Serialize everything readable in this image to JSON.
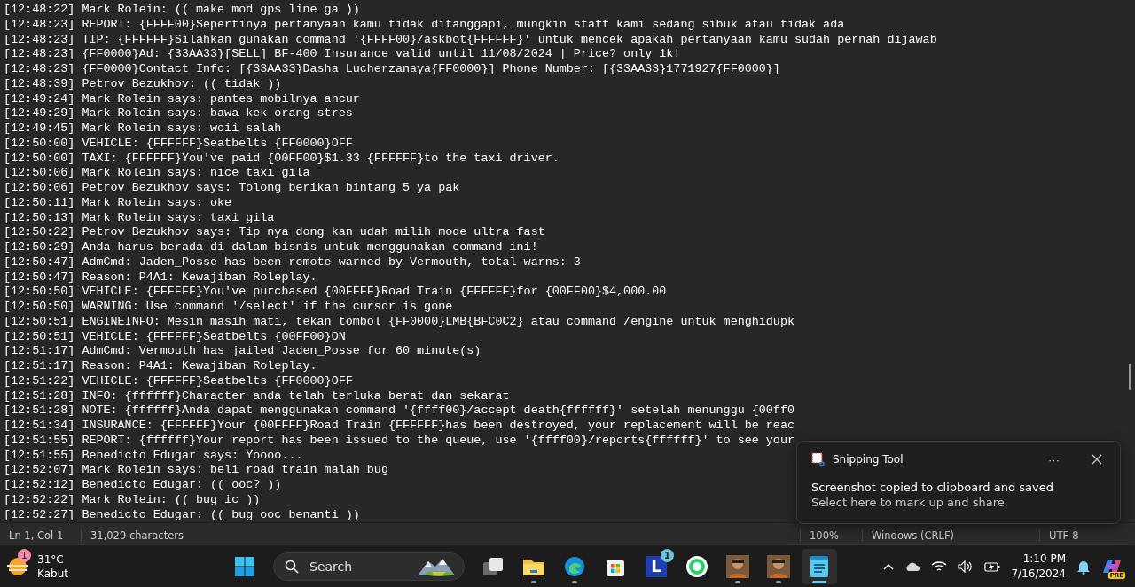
{
  "editor": {
    "lines": [
      "[12:48:22] Mark Rolein: (( make mod gps line ga ))",
      "[12:48:23] REPORT: {FFFF00}Sepertinya pertanyaan kamu tidak ditanggapi, mungkin staff kami sedang sibuk atau tidak ada",
      "[12:48:23] TIP: {FFFFFF}Silahkan gunakan command '{FFFF00}/askbot{FFFFFF}' untuk mencek apakah pertanyaan kamu sudah pernah dijawab",
      "[12:48:23] {FF0000}Ad: {33AA33}[SELL] BF-400 Insurance valid until 11/08/2024 | Price? only 1k!",
      "[12:48:23] {FF0000}Contact Info: [{33AA33}Dasha Lucherzanaya{FF0000}] Phone Number: [{33AA33}1771927{FF0000}]",
      "[12:48:39] Petrov Bezukhov: (( tidak ))",
      "[12:49:24] Mark Rolein says: pantes mobilnya ancur",
      "[12:49:29] Mark Rolein says: bawa kek orang stres",
      "[12:49:45] Mark Rolein says: woii salah",
      "[12:50:00] VEHICLE: {FFFFFF}Seatbelts {FF0000}OFF",
      "[12:50:00] TAXI: {FFFFFF}You've paid {00FF00}$1.33 {FFFFFF}to the taxi driver.",
      "[12:50:06] Mark Rolein says: nice taxi gila",
      "[12:50:06] Petrov Bezukhov says: Tolong berikan bintang 5 ya pak",
      "[12:50:11] Mark Rolein says: oke",
      "[12:50:13] Mark Rolein says: taxi gila",
      "[12:50:22] Petrov Bezukhov says: Tip nya dong kan udah milih mode ultra fast",
      "[12:50:29] Anda harus berada di dalam bisnis untuk menggunakan command ini!",
      "[12:50:47] AdmCmd: Jaden_Posse has been remote warned by Vermouth, total warns: 3",
      "[12:50:47] Reason: P4A1: Kewajiban Roleplay.",
      "[12:50:50] VEHICLE: {FFFFFF}You've purchased {00FFFF}Road Train {FFFFFF}for {00FF00}$4,000.00",
      "[12:50:50] WARNING: Use command '/select' if the cursor is gone",
      "[12:50:51] ENGINEINFO: Mesin masih mati, tekan tombol {FF0000}LMB{BFC0C2} atau command /engine untuk menghidupk",
      "[12:50:51] VEHICLE: {FFFFFF}Seatbelts {00FF00}ON",
      "[12:51:17] AdmCmd: Vermouth has jailed Jaden_Posse for 60 minute(s)",
      "[12:51:17] Reason: P4A1: Kewajiban Roleplay.",
      "[12:51:22] VEHICLE: {FFFFFF}Seatbelts {FF0000}OFF",
      "[12:51:28] INFO: {ffffff}Character anda telah terluka berat dan sekarat",
      "[12:51:28] NOTE: {ffffff}Anda dapat menggunakan command '{ffff00}/accept death{ffffff}' setelah menunggu {00ff0",
      "[12:51:34] INSURANCE: {FFFFFF}Your {00FFFF}Road Train {FFFFFF}has been destroyed, your replacement will be reac",
      "[12:51:55] REPORT: {ffffff}Your report has been issued to the queue, use '{ffff00}/reports{ffffff}' to see your",
      "[12:51:55] Benedicto Edugar says: Yoooo...",
      "[12:52:07] Mark Rolein says: beli road train malah bug",
      "[12:52:12] Benedicto Edugar: (( ooc? ))",
      "[12:52:22] Mark Rolein: (( bug ic ))",
      "[12:52:27] Benedicto Edugar: (( bug ooc benanti ))"
    ]
  },
  "status_bar": {
    "position": "Ln 1, Col 1",
    "characters": "31,029 characters",
    "zoom": "100%",
    "line_ending": "Windows (CRLF)",
    "encoding": "UTF-8"
  },
  "notification": {
    "app": "Snipping Tool",
    "more": "···",
    "title": "Screenshot copied to clipboard and saved",
    "body": "Select here to mark up and share."
  },
  "taskbar": {
    "weather": {
      "badge": "1",
      "temperature": "31°C",
      "condition": "Kabut"
    },
    "search": {
      "placeholder": "Search"
    },
    "apps": [
      {
        "kind": "start",
        "running": false,
        "active": false
      },
      {
        "kind": "taskview",
        "running": false,
        "active": false
      },
      {
        "kind": "explorer",
        "running": true,
        "active": false
      },
      {
        "kind": "edge",
        "running": true,
        "active": false
      },
      {
        "kind": "store",
        "running": false,
        "active": false
      },
      {
        "kind": "letter",
        "label": "L",
        "badge": "1",
        "running": false,
        "active": false
      },
      {
        "kind": "whatsapp",
        "running": false,
        "active": false
      },
      {
        "kind": "game",
        "running": true,
        "active": false
      },
      {
        "kind": "game",
        "running": true,
        "active": false
      },
      {
        "kind": "notepad",
        "running": true,
        "active": true
      }
    ],
    "tray": {
      "time": "1:10 PM",
      "date": "7/16/2024",
      "copilot_badge": "PRE"
    }
  }
}
